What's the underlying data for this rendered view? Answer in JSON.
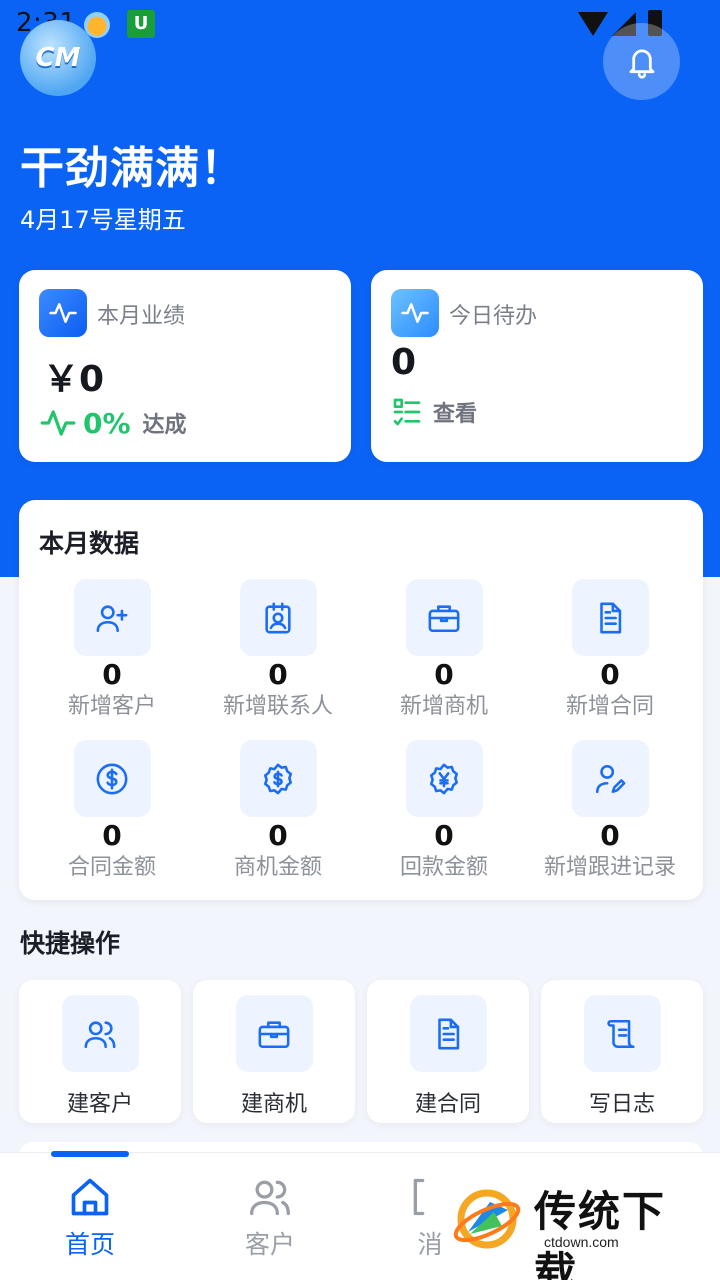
{
  "status_bar": {
    "time": "2:31",
    "app_badge": "U"
  },
  "header": {
    "logo_text": "CM",
    "greeting": "干劲满满！",
    "date": "4月17号星期五"
  },
  "performance_card": {
    "label": "本月业绩",
    "value": "￥0",
    "percent": "0%",
    "reach_label": "达成"
  },
  "todo_card": {
    "label": "今日待办",
    "value": "0",
    "view_label": "查看"
  },
  "monthly_data": {
    "title": "本月数据",
    "items": [
      {
        "icon": "user-add-icon",
        "value": "0",
        "label": "新增客户"
      },
      {
        "icon": "contact-card-icon",
        "value": "0",
        "label": "新增联系人"
      },
      {
        "icon": "briefcase-icon",
        "value": "0",
        "label": "新增商机"
      },
      {
        "icon": "document-icon",
        "value": "0",
        "label": "新增合同"
      },
      {
        "icon": "dollar-circle-icon",
        "value": "0",
        "label": "合同金额"
      },
      {
        "icon": "dollar-badge-icon",
        "value": "0",
        "label": "商机金额"
      },
      {
        "icon": "yen-badge-icon",
        "value": "0",
        "label": "回款金额"
      },
      {
        "icon": "user-edit-icon",
        "value": "0",
        "label": "新增跟进记录"
      }
    ]
  },
  "quick_actions": {
    "title": "快捷操作",
    "items": [
      {
        "icon": "users-icon",
        "label": "建客户"
      },
      {
        "icon": "briefcase-icon",
        "label": "建商机"
      },
      {
        "icon": "document-icon",
        "label": "建合同"
      },
      {
        "icon": "scroll-icon",
        "label": "写日志"
      }
    ]
  },
  "tabbar": {
    "tabs": [
      {
        "icon": "home-icon",
        "label": "首页",
        "active": true
      },
      {
        "icon": "users-icon",
        "label": "客户",
        "active": false
      },
      {
        "icon": "message-icon",
        "label": "消",
        "active": false
      }
    ]
  },
  "watermark": {
    "title": "传统下载",
    "subtitle": "ctdown.com"
  },
  "colors": {
    "primary": "#0b63f6",
    "success": "#21c56b",
    "icon_bg": "#eef4ff"
  }
}
